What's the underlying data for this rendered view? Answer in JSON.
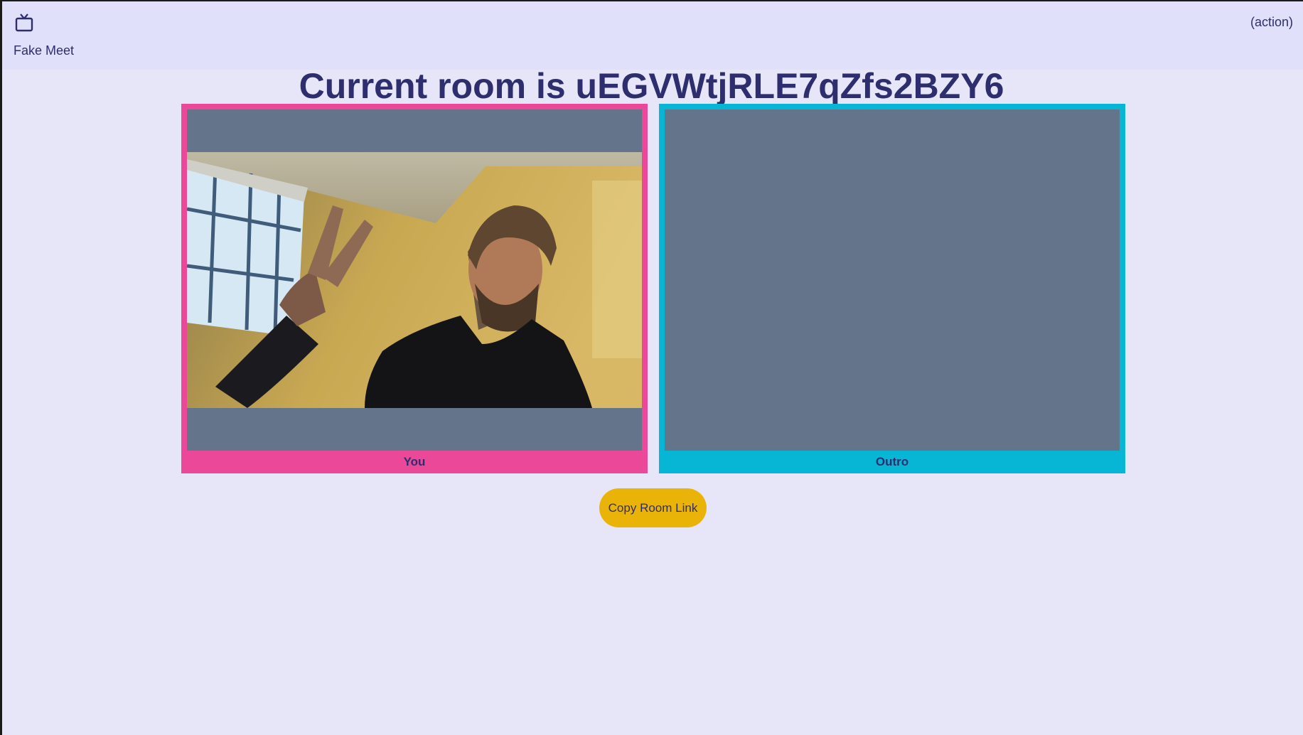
{
  "header": {
    "brand": "Fake Meet",
    "action": "(action)",
    "icon": "tv-icon"
  },
  "room": {
    "title": "Current room is uEGVWtjRLE7qZfs2BZY6"
  },
  "participants": [
    {
      "label": "You",
      "color": "#ec4899",
      "has_video": true
    },
    {
      "label": "Outro",
      "color": "#06b6d4",
      "has_video": false
    }
  ],
  "copy_button": {
    "label": "Copy Room Link",
    "color": "#eab308"
  },
  "colors": {
    "background": "#e6e6f8",
    "header_background": "#e0e0fa",
    "text": "#2e2e6e",
    "video_placeholder": "#64748b"
  }
}
